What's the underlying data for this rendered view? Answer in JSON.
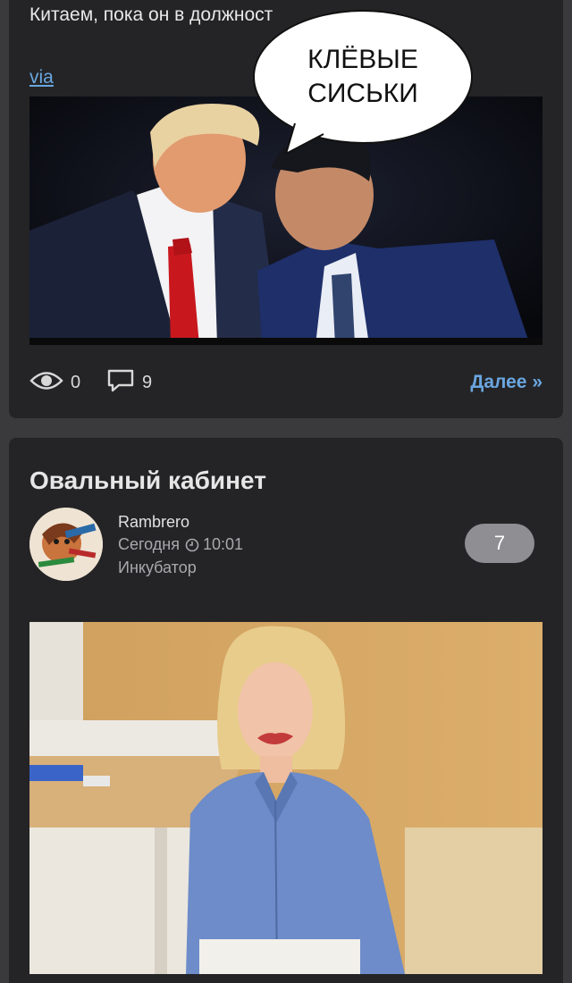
{
  "post1": {
    "text": "Китаем, пока он в должност",
    "via_label": "via",
    "bubble_line1": "КЛЁВЫЕ",
    "bubble_line2": "СИСЬКИ",
    "views": "0",
    "comments": "9",
    "more_label": "Далее »"
  },
  "post2": {
    "title": "Овальный кабинет",
    "author": "Rambrero",
    "date_prefix": "Сегодня",
    "time": "10:01",
    "category": "Инкубатор",
    "rating": "7"
  },
  "colors": {
    "background": "#3a3a3c",
    "card": "#242426",
    "link": "#6aa7e0",
    "badge": "#8e8e93"
  },
  "icons": {
    "views": "eye-icon",
    "comments": "speech-bubble-icon",
    "time": "clock-icon"
  }
}
